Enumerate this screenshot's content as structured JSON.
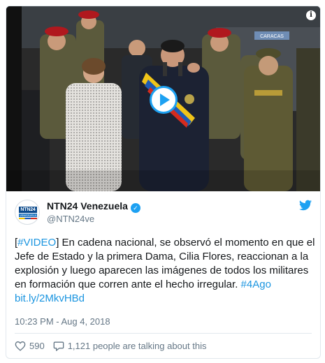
{
  "tweet": {
    "name": "NTN24 Venezuela",
    "handle": "@NTN24ve",
    "avatar": {
      "top_text": "NTN24",
      "bottom_text": "VENEZUELA"
    },
    "text": {
      "hashtag_video": "#VIDEO",
      "main": " En cadena nacional, se observó el momento en que el Jefe de Estado y la primera Dama, Cilia Flores, reaccionan a la explosión y luego aparecen las imágenes de todos los militares en formación que corren ante el hecho irregular. ",
      "hashtag_4ago": "#4Ago",
      "link": "bit.ly/2MkvHBd"
    },
    "timestamp": "10:23 PM - Aug 4, 2018",
    "likes": "590",
    "talking": "1,121 people are talking about this"
  },
  "media": {
    "sign_text": "CARACAS",
    "info_icon": "i"
  },
  "icons": {
    "play": "play-icon",
    "info": "info-icon",
    "verified": "verified-badge-icon",
    "bird": "twitter-bird-icon",
    "heart": "heart-icon",
    "reply": "reply-bubble-icon"
  },
  "colors": {
    "accent": "#1da1f2",
    "link": "#1b95e0",
    "muted": "#657786",
    "border": "#e1e8ed"
  }
}
